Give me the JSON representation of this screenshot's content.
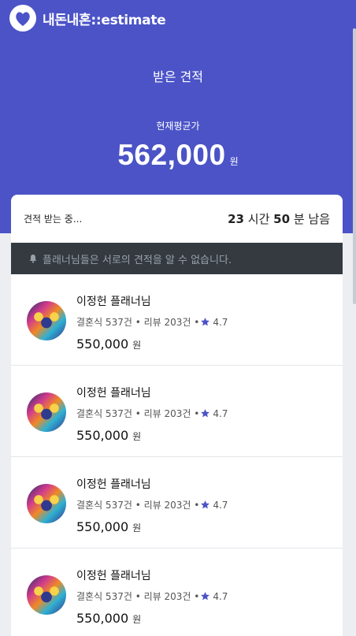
{
  "header": {
    "brand": "내돈내혼::estimate"
  },
  "hero": {
    "title": "받은 견적",
    "avg_label": "현재평균가",
    "avg_value": "562,000",
    "avg_unit": "원"
  },
  "status": {
    "label": "견적 받는 중...",
    "hours": "23",
    "hours_unit": "시간",
    "minutes": "50",
    "minutes_unit": "분 남음"
  },
  "notice": {
    "text": "플래너님들은 서로의 견적을 알 수 없습니다."
  },
  "quotes": [
    {
      "name": "이정헌 플래너님",
      "meta": "결혼식 537건 • 리뷰 203건 •",
      "rating": "4.7",
      "price": "550,000",
      "unit": "원"
    },
    {
      "name": "이정헌 플래너님",
      "meta": "결혼식 537건 • 리뷰 203건 •",
      "rating": "4.7",
      "price": "550,000",
      "unit": "원"
    },
    {
      "name": "이정헌 플래너님",
      "meta": "결혼식 537건 • 리뷰 203건 •",
      "rating": "4.7",
      "price": "550,000",
      "unit": "원"
    },
    {
      "name": "이정헌 플래너님",
      "meta": "결혼식 537건 • 리뷰 203건 •",
      "rating": "4.7",
      "price": "550,000",
      "unit": "원"
    }
  ],
  "colors": {
    "brand": "#4b53c7",
    "notice_bg": "#343a40",
    "star": "#4b53c7"
  },
  "icons": {
    "logo": "heart-logo-icon",
    "notice": "bell-icon",
    "rating": "star-icon"
  }
}
